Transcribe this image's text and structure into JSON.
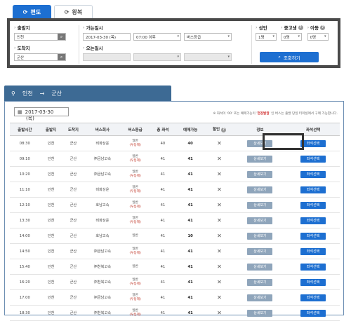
{
  "tabs": {
    "oneway": "편도",
    "roundtrip": "왕복"
  },
  "search": {
    "departure_label": "출발지",
    "departure_value": "인천",
    "arrival_label": "도착지",
    "arrival_value": "군산",
    "go_date_label": "가는일시",
    "go_date_value": "2017-03-30 (목)",
    "go_time_value": "07:00 이후",
    "go_grade_value": "버스등급",
    "return_date_label": "오는일시",
    "adult_label": "성인",
    "adult_value": "1명",
    "youth_label": "중고생",
    "youth_value": "0명",
    "child_label": "아동",
    "child_value": "0명",
    "lookup_button": "조회하기"
  },
  "route": {
    "from": "인천",
    "arrow": "→",
    "to": "군산"
  },
  "result": {
    "date": "2017-03-30",
    "weekday": "(목)",
    "notice_a": "※ 좌석이 '00' 또는 예매가능이 '",
    "notice_red": "현장발권",
    "notice_b": "' 인 버스는 출발 당일 터미널에서 구매 가능합니다."
  },
  "table": {
    "headers": [
      "출발시간",
      "출발지",
      "도착지",
      "버스회사",
      "버스등급",
      "총 좌석",
      "예매가능",
      "할인",
      "정보",
      "좌석선택"
    ],
    "detail_label": "상세보기",
    "seat_label": "좌석선택",
    "rows": [
      {
        "time": "08:30",
        "from": "인천",
        "to": "군산",
        "company": "비화상운",
        "grade1": "일반",
        "grade2": "(우등제)",
        "total": "40",
        "avail": "40"
      },
      {
        "time": "09:10",
        "from": "인천",
        "to": "군산",
        "company": "㈜금남고속",
        "grade1": "일반",
        "grade2": "(우등제)",
        "total": "41",
        "avail": "41"
      },
      {
        "time": "10:20",
        "from": "인천",
        "to": "군산",
        "company": "㈜금남고속",
        "grade1": "일반",
        "grade2": "(우등제)",
        "total": "41",
        "avail": "41"
      },
      {
        "time": "11:10",
        "from": "인천",
        "to": "군산",
        "company": "비화상운",
        "grade1": "일반",
        "grade2": "(우등제)",
        "total": "41",
        "avail": "41"
      },
      {
        "time": "12:10",
        "from": "인천",
        "to": "군산",
        "company": "호남고속",
        "grade1": "일반",
        "grade2": "(우등제)",
        "total": "41",
        "avail": "41"
      },
      {
        "time": "13:30",
        "from": "인천",
        "to": "군산",
        "company": "비화상운",
        "grade1": "일반",
        "grade2": "(우등제)",
        "total": "41",
        "avail": "41"
      },
      {
        "time": "14:00",
        "from": "인천",
        "to": "군산",
        "company": "호남고속",
        "grade1": "일반",
        "grade2": "",
        "total": "41",
        "avail": "10"
      },
      {
        "time": "14:50",
        "from": "인천",
        "to": "군산",
        "company": "㈜금남고속",
        "grade1": "일반",
        "grade2": "(우등제)",
        "total": "41",
        "avail": "41"
      },
      {
        "time": "15:40",
        "from": "인천",
        "to": "군산",
        "company": "㈜천북고속",
        "grade1": "일반",
        "grade2": "",
        "total": "41",
        "avail": "41"
      },
      {
        "time": "16:20",
        "from": "인천",
        "to": "군산",
        "company": "㈜천북고속",
        "grade1": "일반",
        "grade2": "(우등제)",
        "total": "41",
        "avail": "41"
      },
      {
        "time": "17:00",
        "from": "인천",
        "to": "군산",
        "company": "㈜금남고속",
        "grade1": "일반",
        "grade2": "(우등제)",
        "total": "41",
        "avail": "41"
      },
      {
        "time": "18:30",
        "from": "인천",
        "to": "군산",
        "company": "㈜천북고속",
        "grade1": "일반",
        "grade2": "(우등제)",
        "total": "41",
        "avail": "41"
      }
    ]
  }
}
